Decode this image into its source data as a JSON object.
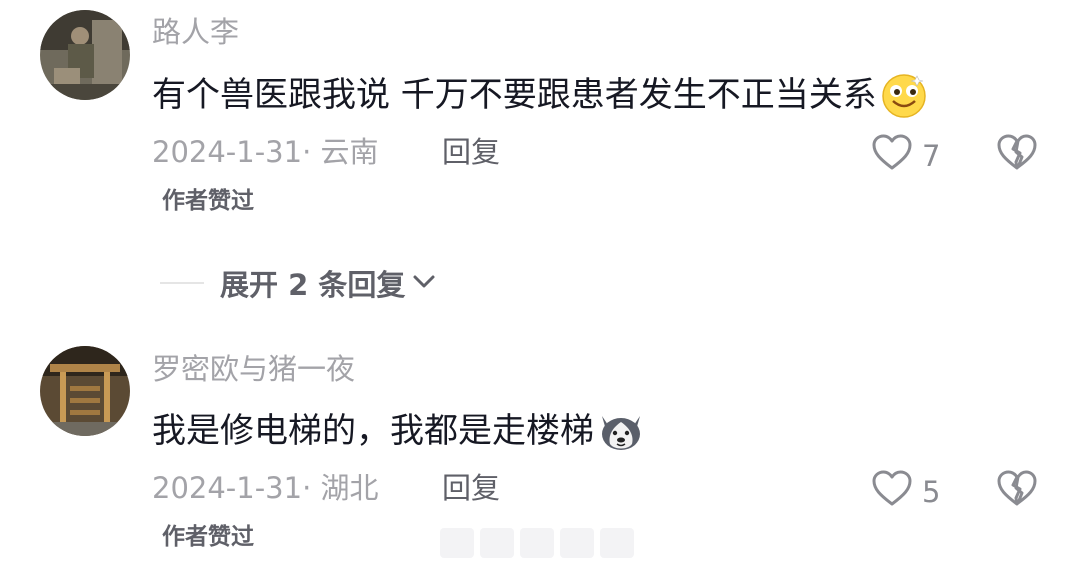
{
  "comments": [
    {
      "username": "路人李",
      "text": "有个兽医跟我说 千万不要跟患者发生不正当关系",
      "emoji": "grinning-face-emoji",
      "date_location": "2024-1-31· 云南",
      "reply_label": "回复",
      "like_count": "7",
      "author_liked": "作者赞过"
    },
    {
      "username": "罗密欧与猪一夜",
      "text": "我是修电梯的，我都是走楼梯",
      "emoji": "husky-dog-emoji",
      "date_location": "2024-1-31· 湖北",
      "reply_label": "回复",
      "like_count": "5",
      "author_liked": "作者赞过"
    }
  ],
  "expand_replies": {
    "label": "展开 2 条回复"
  },
  "colors": {
    "text": "#161823",
    "muted": "#a3a3a8",
    "secondary": "#5f6068",
    "background": "#ffffff"
  }
}
